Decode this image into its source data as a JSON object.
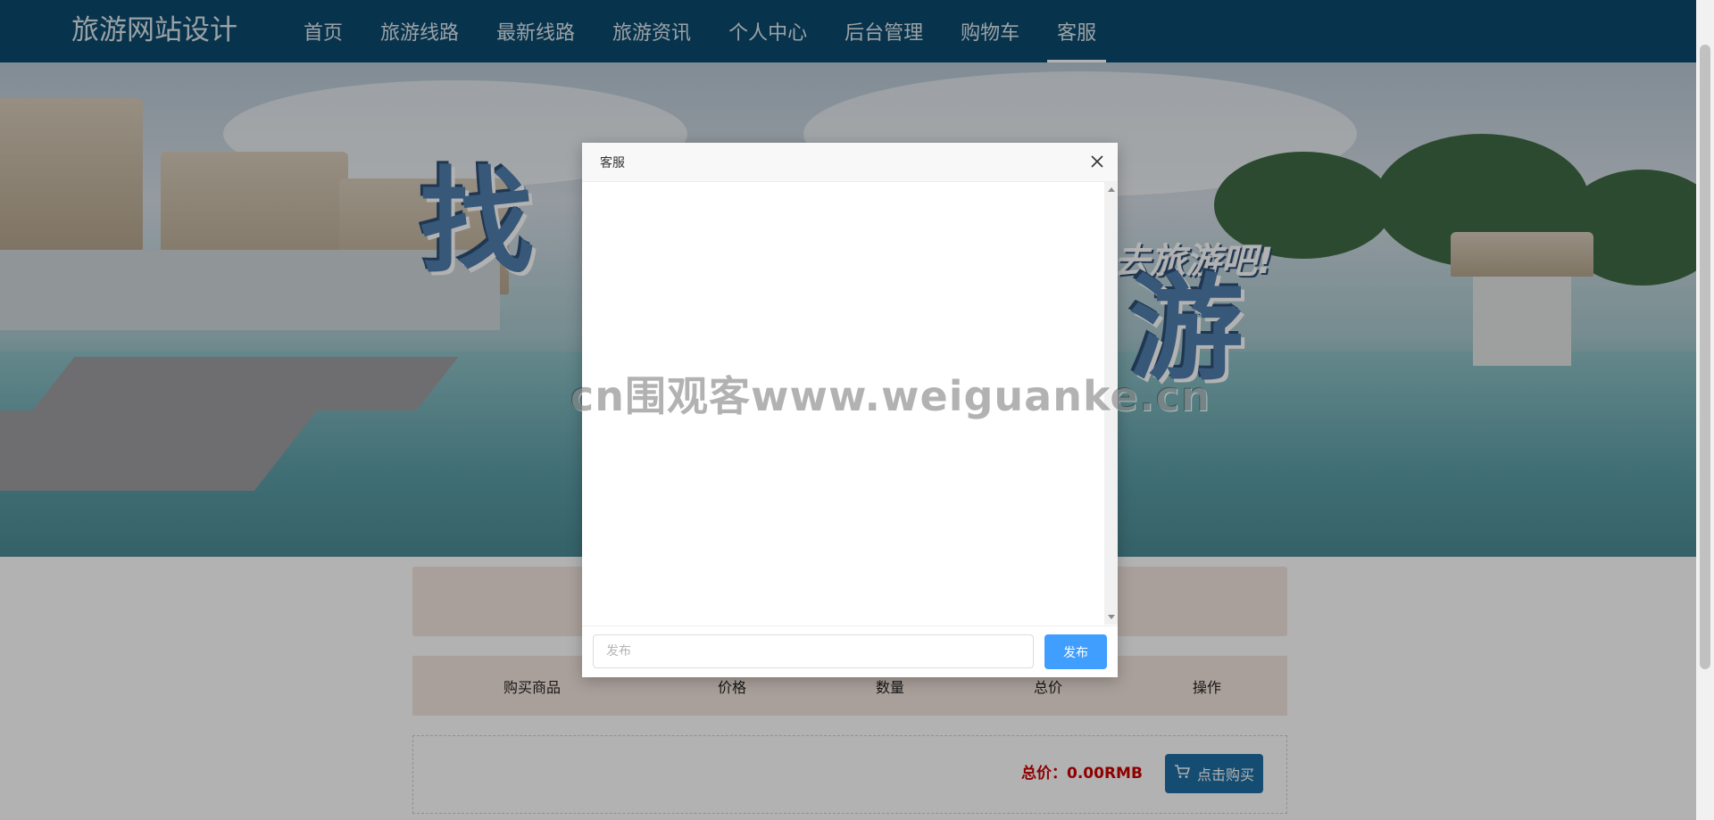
{
  "brand": "旅游网站设计",
  "nav": {
    "items": [
      {
        "label": "首页"
      },
      {
        "label": "旅游线路"
      },
      {
        "label": "最新线路"
      },
      {
        "label": "旅游资讯"
      },
      {
        "label": "个人中心"
      },
      {
        "label": "后台管理"
      },
      {
        "label": "购物车"
      },
      {
        "label": "客服",
        "active": true
      }
    ]
  },
  "banner": {
    "slogan_left": "找",
    "slogan_right": "游",
    "slogan_small": "去旅游吧!"
  },
  "cart": {
    "columns": [
      "购买商品",
      "价格",
      "数量",
      "总价",
      "操作"
    ],
    "total_label": "总价：0.00RMB",
    "buy_label": "点击购买"
  },
  "dialog": {
    "title": "客服",
    "input_placeholder": "发布",
    "send_label": "发布"
  },
  "watermark": "cn围观客www.weiguanke.cn",
  "colors": {
    "nav_bg": "#0b4a6e",
    "cart_bg": "#f4e6df",
    "buy_button": "#1e6fa3",
    "send_button": "#409eff",
    "total_text": "#cc0000"
  },
  "icons": {
    "close": "close-icon",
    "cart": "cart-icon"
  }
}
